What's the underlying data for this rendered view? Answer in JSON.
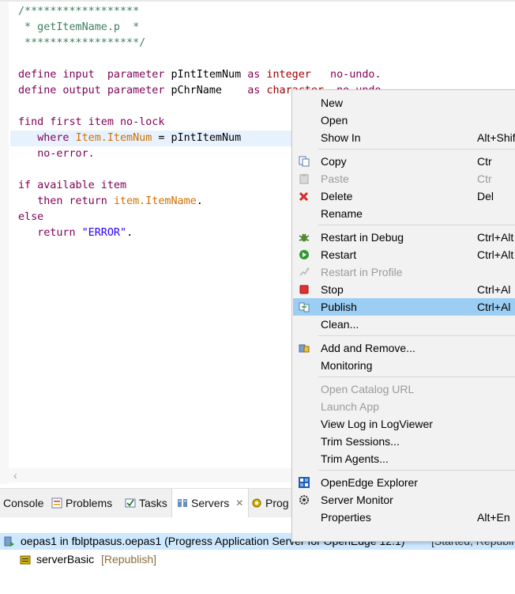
{
  "editor": {
    "lines": [
      {
        "parts": [
          [
            "cmt",
            "/******************"
          ]
        ]
      },
      {
        "parts": [
          [
            "cmt",
            " * getItemName.p  *"
          ]
        ]
      },
      {
        "parts": [
          [
            "cmt",
            " ******************/"
          ]
        ]
      },
      {
        "parts": [
          [
            "",
            ""
          ]
        ]
      },
      {
        "parts": [
          [
            "kw",
            "define input  parameter "
          ],
          [
            "",
            "pIntItemNum "
          ],
          [
            "kw",
            "as "
          ],
          [
            "ty",
            "integer"
          ],
          [
            "",
            "   "
          ],
          [
            "kw",
            "no-undo."
          ]
        ]
      },
      {
        "parts": [
          [
            "kw",
            "define output parameter "
          ],
          [
            "",
            "pChrName    "
          ],
          [
            "kw",
            "as "
          ],
          [
            "ty",
            "character"
          ],
          [
            "",
            "  "
          ],
          [
            "kw",
            "no-undo."
          ]
        ]
      },
      {
        "parts": [
          [
            "",
            ""
          ]
        ]
      },
      {
        "parts": [
          [
            "kw",
            "find first item no-lock"
          ]
        ]
      },
      {
        "parts": [
          [
            "",
            "   "
          ],
          [
            "kw",
            "where "
          ],
          [
            "fld",
            "Item.ItemNum"
          ],
          [
            "",
            " = pIntItemNum"
          ]
        ],
        "highlight": true
      },
      {
        "parts": [
          [
            "",
            "   "
          ],
          [
            "kw",
            "no-error."
          ]
        ]
      },
      {
        "parts": [
          [
            "",
            ""
          ]
        ]
      },
      {
        "parts": [
          [
            "kw",
            "if available item"
          ]
        ]
      },
      {
        "parts": [
          [
            "",
            "   "
          ],
          [
            "kw",
            "then return "
          ],
          [
            "fld",
            "item.ItemName"
          ],
          [
            "",
            "."
          ]
        ]
      },
      {
        "parts": [
          [
            "kw",
            "else"
          ]
        ]
      },
      {
        "parts": [
          [
            "",
            "   "
          ],
          [
            "kw",
            "return "
          ],
          [
            "str",
            "\"ERROR\""
          ],
          [
            "",
            "."
          ]
        ]
      }
    ]
  },
  "tabs": [
    {
      "label": "Console",
      "icon": "console-icon"
    },
    {
      "label": "Problems",
      "icon": "problems-icon"
    },
    {
      "label": "Tasks",
      "icon": "tasks-icon"
    },
    {
      "label": "Servers",
      "icon": "servers-icon",
      "active": true
    },
    {
      "label": "Prog",
      "icon": "progress-icon"
    }
  ],
  "servers": {
    "row1": {
      "name": "oepas1 in fblptpasus.oepas1 (Progress Application Server for OpenEdge 12.1)",
      "state": "[Started, Republi"
    },
    "row2": {
      "name": "serverBasic",
      "state": "[Republish]"
    }
  },
  "menu": {
    "groups": [
      [
        {
          "label": "New",
          "acc": "",
          "icon": ""
        },
        {
          "label": "Open",
          "acc": "",
          "icon": ""
        },
        {
          "label": "Show In",
          "acc": "Alt+Shift",
          "icon": ""
        }
      ],
      [
        {
          "label": "Copy",
          "acc": "Ctr",
          "icon": "copy-icon"
        },
        {
          "label": "Paste",
          "acc": "Ctr",
          "icon": "paste-icon",
          "disabled": true
        },
        {
          "label": "Delete",
          "acc": "Del",
          "icon": "delete-icon"
        },
        {
          "label": "Rename",
          "acc": "",
          "icon": ""
        }
      ],
      [
        {
          "label": "Restart in Debug",
          "acc": "Ctrl+Alt",
          "icon": "debug-icon"
        },
        {
          "label": "Restart",
          "acc": "Ctrl+Alt",
          "icon": "restart-icon"
        },
        {
          "label": "Restart in Profile",
          "acc": "",
          "icon": "profile-icon",
          "disabled": true
        },
        {
          "label": "Stop",
          "acc": "Ctrl+Al",
          "icon": "stop-icon"
        },
        {
          "label": "Publish",
          "acc": "Ctrl+Al",
          "icon": "publish-icon",
          "selected": true
        },
        {
          "label": "Clean...",
          "acc": "",
          "icon": ""
        }
      ],
      [
        {
          "label": "Add and Remove...",
          "acc": "",
          "icon": "add-remove-icon"
        },
        {
          "label": "Monitoring",
          "acc": "",
          "icon": ""
        }
      ],
      [
        {
          "label": "Open Catalog URL",
          "acc": "",
          "icon": "",
          "disabled": true
        },
        {
          "label": "Launch App",
          "acc": "",
          "icon": "",
          "disabled": true
        },
        {
          "label": "View Log in LogViewer",
          "acc": "",
          "icon": ""
        },
        {
          "label": "Trim Sessions...",
          "acc": "",
          "icon": ""
        },
        {
          "label": "Trim Agents...",
          "acc": "",
          "icon": ""
        }
      ],
      [
        {
          "label": "OpenEdge Explorer",
          "acc": "",
          "icon": "openedge-explorer-icon"
        },
        {
          "label": "Server Monitor",
          "acc": "",
          "icon": "server-monitor-icon"
        },
        {
          "label": "Properties",
          "acc": "Alt+En",
          "icon": ""
        }
      ]
    ]
  },
  "colors": {
    "selection": "#9ccef4",
    "menu_bg": "#f2f2f2",
    "keyword": "#7f0055",
    "comment": "#3f7f5f"
  }
}
